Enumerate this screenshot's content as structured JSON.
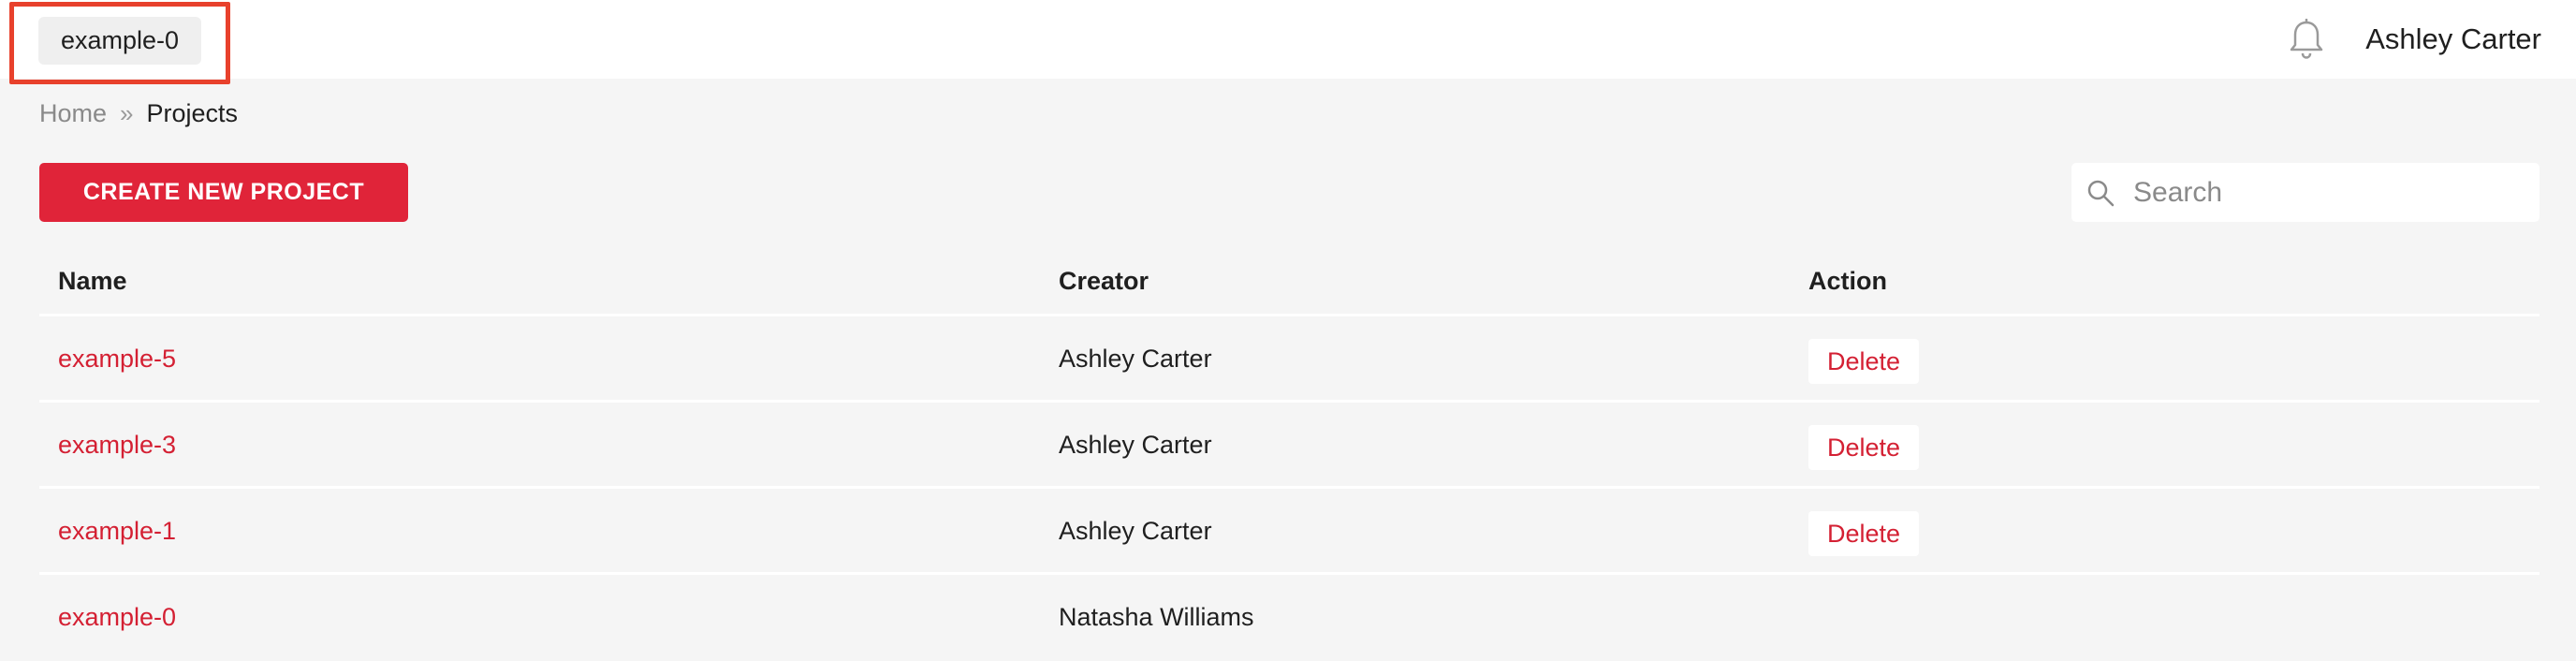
{
  "header": {
    "project_switcher_label": "example-0",
    "user_name": "Ashley Carter",
    "bell_icon": "bell-icon"
  },
  "breadcrumb": {
    "home": "Home",
    "separator": "»",
    "current": "Projects"
  },
  "toolbar": {
    "create_label": "CREATE NEW PROJECT",
    "search_placeholder": "Search",
    "search_value": ""
  },
  "table": {
    "columns": [
      "Name",
      "Creator",
      "Action"
    ],
    "rows": [
      {
        "name": "example-5",
        "creator": "Ashley Carter",
        "action": "Delete"
      },
      {
        "name": "example-3",
        "creator": "Ashley Carter",
        "action": "Delete"
      },
      {
        "name": "example-1",
        "creator": "Ashley Carter",
        "action": "Delete"
      },
      {
        "name": "example-0",
        "creator": "Natasha Williams",
        "action": ""
      }
    ]
  },
  "colors": {
    "accent": "#e02439",
    "link": "#d42033",
    "highlight_border": "#e8412c",
    "background": "#f5f5f5"
  }
}
